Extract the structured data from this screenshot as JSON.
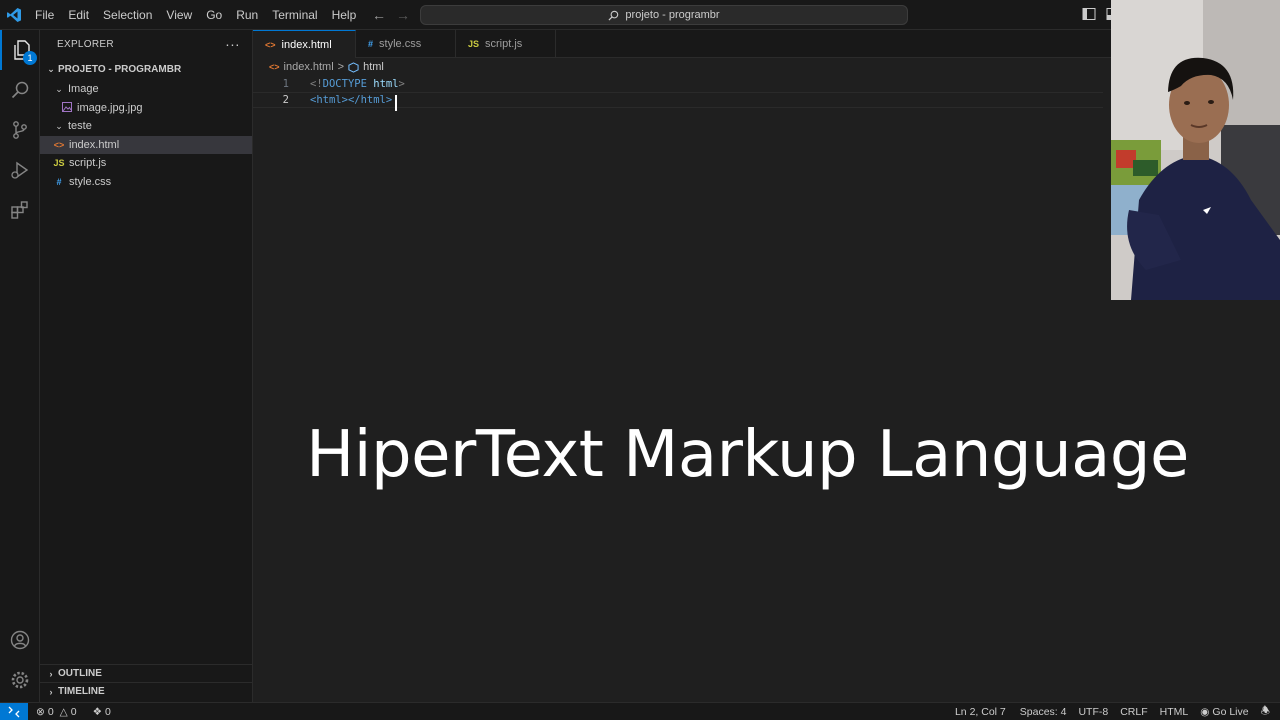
{
  "menu": [
    "File",
    "Edit",
    "Selection",
    "View",
    "Go",
    "Run",
    "Terminal",
    "Help"
  ],
  "command_center": {
    "text": "projeto - programbr"
  },
  "activity_bar": {
    "explorer_badge": "1"
  },
  "sidebar": {
    "title": "EXPLORER",
    "more": "···",
    "folder": "PROJETO - PROGRAMBR",
    "tree": [
      {
        "label": "Image",
        "type": "folder",
        "level": 0
      },
      {
        "label": "image.jpg.jpg",
        "type": "image",
        "level": 1
      },
      {
        "label": "teste",
        "type": "folder",
        "level": 0
      },
      {
        "label": "index.html",
        "type": "html",
        "level": 0,
        "selected": true
      },
      {
        "label": "script.js",
        "type": "js",
        "level": 0
      },
      {
        "label": "style.css",
        "type": "css",
        "level": 0
      }
    ],
    "outline": "OUTLINE",
    "timeline": "TIMELINE"
  },
  "tabs": [
    {
      "label": "index.html",
      "icon": "<>",
      "active": true,
      "dirty": true
    },
    {
      "label": "style.css",
      "icon": "#",
      "active": false
    },
    {
      "label": "script.js",
      "icon": "JS",
      "active": false
    }
  ],
  "breadcrumb": {
    "file": "index.html",
    "sep": ">",
    "symbol": "html"
  },
  "editor": {
    "lines": [
      {
        "num": "1",
        "punct_open": "<!",
        "tag": "DOCTYPE",
        "attr": "html",
        "punct_close": ">"
      },
      {
        "num": "2",
        "open": "<html>",
        "close": "</html>"
      }
    ]
  },
  "caption": "HiperText Markup Language",
  "status": {
    "errors": "0",
    "warnings": "0",
    "ports": "0",
    "position": "Ln 2, Col 7",
    "spaces": "Spaces: 4",
    "encoding": "UTF-8",
    "eol": "CRLF",
    "language": "HTML",
    "golive": "Go Live"
  },
  "colors": {
    "accent": "#0078d4",
    "html_icon": "#e37933",
    "css_icon": "#42a5f5",
    "js_icon": "#cbcb41",
    "tag": "#569cd6",
    "attr": "#9cdcfe"
  }
}
